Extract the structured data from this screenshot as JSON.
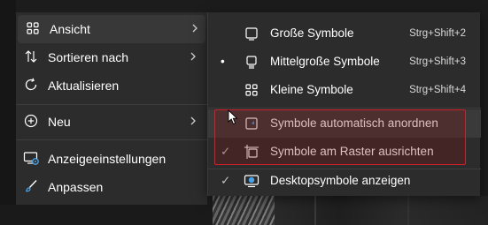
{
  "context_menu": {
    "items": [
      {
        "label": "Ansicht",
        "icon": "grid-view-icon",
        "has_submenu": true
      },
      {
        "label": "Sortieren nach",
        "icon": "sort-arrows-icon",
        "has_submenu": true
      },
      {
        "label": "Aktualisieren",
        "icon": "refresh-icon",
        "has_submenu": false
      },
      {
        "label": "Neu",
        "icon": "add-circle-icon",
        "has_submenu": true
      },
      {
        "label": "Anzeigeeinstellungen",
        "icon": "display-settings-icon",
        "has_submenu": false
      },
      {
        "label": "Anpassen",
        "icon": "paintbrush-icon",
        "has_submenu": false
      }
    ]
  },
  "submenu": {
    "items": [
      {
        "label": "Große Symbole",
        "shortcut": "Strg+Shift+2",
        "icon": "large-icons-icon",
        "mark": ""
      },
      {
        "label": "Mittelgroße Symbole",
        "shortcut": "Strg+Shift+3",
        "icon": "medium-icons-icon",
        "mark": "•"
      },
      {
        "label": "Kleine Symbole",
        "shortcut": "Strg+Shift+4",
        "icon": "small-icons-icon",
        "mark": ""
      },
      {
        "label": "Symbole automatisch anordnen",
        "shortcut": "",
        "icon": "auto-arrange-icon",
        "mark": ""
      },
      {
        "label": "Symbole am Raster ausrichten",
        "shortcut": "",
        "icon": "align-grid-icon",
        "mark": "✓"
      },
      {
        "label": "Desktopsymbole anzeigen",
        "shortcut": "",
        "icon": "desktop-icons-icon",
        "mark": "✓"
      }
    ]
  },
  "colors": {
    "menu_bg": "#2c2c2c",
    "highlight_border": "#d0202a",
    "accent_blue": "#4aa3e8"
  }
}
